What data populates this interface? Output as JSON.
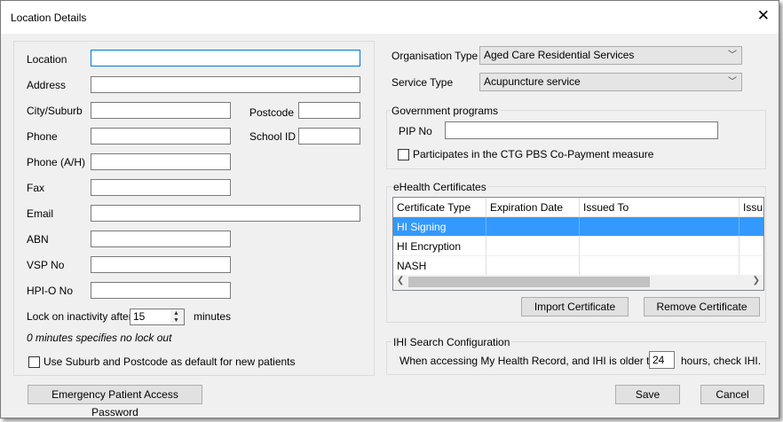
{
  "window": {
    "title": "Location Details"
  },
  "left": {
    "location_label": "Location",
    "location_value": "",
    "address_label": "Address",
    "city_label": "City/Suburb",
    "postcode_label": "Postcode",
    "phone_label": "Phone",
    "school_id_label": "School ID",
    "phone_ah_label": "Phone (A/H)",
    "fax_label": "Fax",
    "email_label": "Email",
    "abn_label": "ABN",
    "vsp_label": "VSP No",
    "hpio_label": "HPI-O No",
    "lock_label": "Lock on inactivity after",
    "lock_value": "15",
    "lock_units": "minutes",
    "lock_note": "0 minutes specifies no lock out",
    "use_suburb_label": "Use Suburb and Postcode as default for new patients",
    "use_suburb_checked": false
  },
  "right": {
    "org_type_label": "Organisation Type",
    "org_type_value": "Aged Care Residential Services",
    "service_type_label": "Service Type",
    "service_type_value": "Acupuncture service",
    "gov_title": "Government programs",
    "pip_label": "PIP No",
    "ctg_label": "Participates in the CTG PBS Co-Payment measure",
    "ctg_checked": false,
    "ehealth_title": "eHealth Certificates",
    "cert_columns": [
      "Certificate Type",
      "Expiration Date",
      "Issued To",
      "Issu"
    ],
    "cert_rows": [
      {
        "type": "HI Signing",
        "expiration": "",
        "issued_to": "",
        "selected": true
      },
      {
        "type": "HI Encryption",
        "expiration": "",
        "issued_to": "",
        "selected": false
      },
      {
        "type": "NASH",
        "expiration": "",
        "issued_to": "",
        "selected": false
      }
    ],
    "import_button": "Import Certificate",
    "remove_button": "Remove Certificate",
    "ihi_title": "IHI Search Configuration",
    "ihi_text_before": "When accessing My Health Record, and IHI is older than",
    "ihi_hours": "24",
    "ihi_text_after": "hours, check IHI."
  },
  "footer": {
    "emergency_button": "Emergency Patient Access Password",
    "save_button": "Save",
    "cancel_button": "Cancel"
  }
}
